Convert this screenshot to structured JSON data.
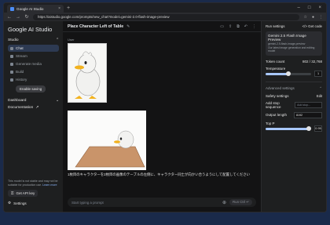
{
  "browser": {
    "tab_title": "Google AI Studio",
    "url": "https://aistudio.google.com/prompts/new_chat?model=gemini-2.0-flash-image-preview"
  },
  "sidebar": {
    "brand": "Google AI Studio",
    "studio_label": "Studio",
    "items": [
      {
        "label": "Chat",
        "icon": "chat-icon"
      },
      {
        "label": "Stream",
        "icon": "stream-icon"
      },
      {
        "label": "Generate media",
        "icon": "media-icon"
      },
      {
        "label": "Build",
        "icon": "build-icon"
      },
      {
        "label": "History",
        "icon": "history-icon"
      }
    ],
    "saving_button": "Enable saving",
    "dashboard_label": "Dashboard",
    "documentation_label": "Documentation",
    "foot_note": "This model is not stable and may not be suitable for production use.",
    "learn_more": "Learn more",
    "api_key_button": "Get API key",
    "settings_label": "Settings"
  },
  "main": {
    "title": "Place Character Left of Table",
    "user_label": "User",
    "message": "1枚目のキャラクターを2枚目の画像のテーブルの左側に、キャラクター同士が向かい合うようにして配置してください",
    "prompt_placeholder": "Start typing a prompt",
    "run_label": "Run  Ctrl ↵"
  },
  "right": {
    "run_settings": "Run settings",
    "get_code": "Get code",
    "model_name": "Gemini 2.5 Flash Image Preview",
    "model_id": "gemini-2.5-flash-image-preview",
    "model_desc": "Our latest image generation and editing model",
    "token_label": "Token count",
    "token_value": "802 / 32,768",
    "temperature_label": "Temperature",
    "temperature_value": "1",
    "advanced_label": "Advanced settings",
    "safety_label": "Safety settings",
    "safety_edit": "Edit",
    "stop_label": "Add stop sequence",
    "stop_placeholder": "Add stop...",
    "output_label": "Output length",
    "output_value": "8192",
    "topp_label": "Top P",
    "topp_value": "0.95"
  }
}
